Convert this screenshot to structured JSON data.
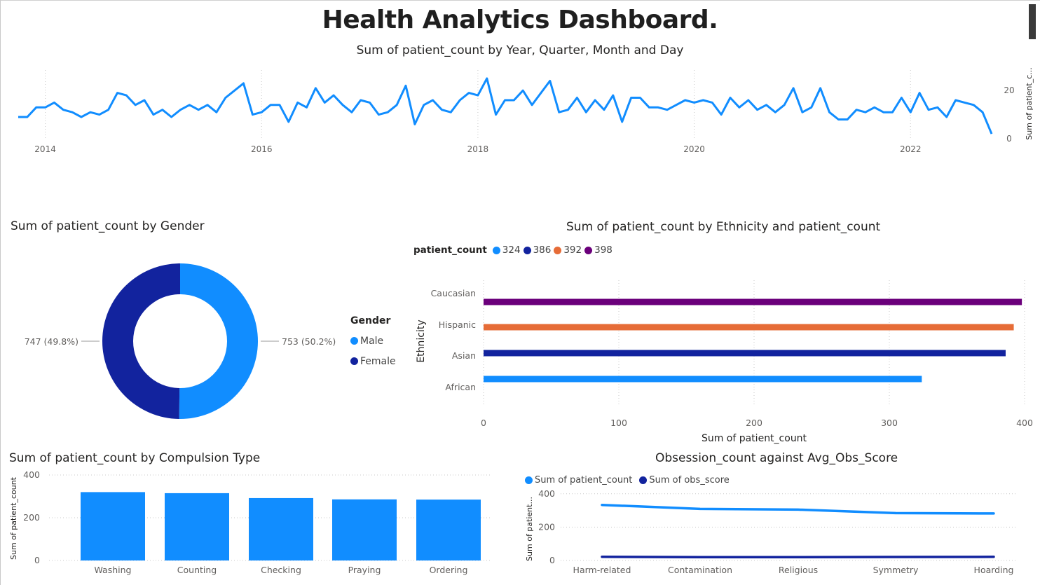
{
  "dashboard": {
    "title": "Health Analytics Dashboard."
  },
  "colors": {
    "blue": "#118DFF",
    "navy": "#12239E",
    "orange": "#E66C37",
    "purple": "#6B007B",
    "grid": "#c8c8c8",
    "label": "#605E5C"
  },
  "timeline": {
    "title": "Sum of patient_count by Year, Quarter, Month and Day",
    "ylabel": "Sum of patient_c...",
    "chart_data": {
      "type": "line",
      "title": "Sum of patient_count by Year, Quarter, Month and Day",
      "ylabel": "Sum of patient_c...",
      "x_ticks": [
        "2014",
        "2016",
        "2018",
        "2020",
        "2022"
      ],
      "x_start_year": 2013.75,
      "ylim": [
        0,
        25
      ],
      "y_ticks": [
        0,
        20
      ],
      "values": [
        9,
        9,
        13,
        13,
        15,
        12,
        11,
        9,
        11,
        10,
        12,
        19,
        18,
        14,
        16,
        10,
        12,
        9,
        12,
        14,
        12,
        14,
        11,
        17,
        20,
        23,
        10,
        11,
        14,
        14,
        7,
        15,
        13,
        21,
        15,
        18,
        14,
        11,
        16,
        15,
        10,
        11,
        14,
        22,
        6,
        14,
        16,
        12,
        11,
        16,
        19,
        18,
        25,
        10,
        16,
        16,
        20,
        14,
        19,
        24,
        11,
        12,
        17,
        11,
        16,
        12,
        18,
        7,
        17,
        17,
        13,
        13,
        12,
        14,
        16,
        15,
        16,
        15,
        10,
        17,
        13,
        16,
        12,
        14,
        11,
        14,
        21,
        11,
        13,
        21,
        11,
        8,
        8,
        12,
        11,
        13,
        11,
        11,
        17,
        11,
        19,
        12,
        13,
        9,
        16,
        15,
        14,
        11,
        2
      ]
    }
  },
  "gender": {
    "title": "Sum of patient_count by Gender",
    "legend_title": "Gender",
    "chart_data": {
      "type": "pie",
      "title": "Sum of patient_count by Gender",
      "categories": [
        "Male",
        "Female"
      ],
      "values": [
        753,
        747
      ],
      "labels": [
        "753 (50.2%)",
        "747 (49.8%)"
      ],
      "donut": true
    }
  },
  "ethnicity": {
    "title": "Sum of patient_count by Ethnicity and patient_count",
    "legend_title": "patient_count",
    "chart_data": {
      "type": "bar",
      "orientation": "horizontal",
      "title": "Sum of patient_count by Ethnicity and patient_count",
      "xlabel": "Sum of patient_count",
      "ylabel": "Ethnicity",
      "categories": [
        "Caucasian",
        "Hispanic",
        "Asian",
        "African"
      ],
      "values": [
        398,
        392,
        386,
        324
      ],
      "legend": [
        "324",
        "386",
        "392",
        "398"
      ],
      "xlim": [
        0,
        400
      ],
      "x_ticks": [
        0,
        100,
        200,
        300,
        400
      ]
    }
  },
  "compulsion": {
    "title": "Sum of patient_count by Compulsion Type",
    "ylabel": "Sum of patient_count",
    "chart_data": {
      "type": "bar",
      "title": "Sum of patient_count by Compulsion Type",
      "ylabel": "Sum of patient_count",
      "categories": [
        "Washing",
        "Counting",
        "Checking",
        "Praying",
        "Ordering"
      ],
      "values": [
        320,
        315,
        292,
        286,
        285
      ],
      "ylim": [
        0,
        400
      ],
      "y_ticks": [
        0,
        200,
        400
      ]
    }
  },
  "obsession": {
    "title": "Obsession_count against Avg_Obs_Score",
    "ylabel": "Sum of patient...",
    "chart_data": {
      "type": "line",
      "title": "Obsession_count against Avg_Obs_Score",
      "ylabel": "Sum of patient...",
      "categories": [
        "Harm-related",
        "Contamination",
        "Religious",
        "Symmetry",
        "Hoarding"
      ],
      "series": [
        {
          "name": "Sum of patient_count",
          "values": [
            333,
            309,
            305,
            284,
            282
          ]
        },
        {
          "name": "Sum of obs_score",
          "values": [
            22,
            20,
            20,
            21,
            22
          ]
        }
      ],
      "ylim": [
        0,
        420
      ],
      "y_ticks": [
        0,
        200,
        400
      ]
    }
  }
}
